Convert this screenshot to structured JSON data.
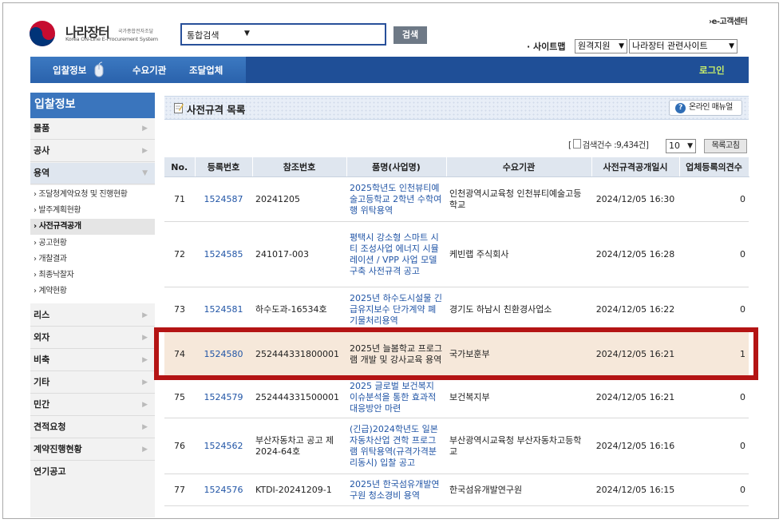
{
  "header": {
    "logo_title": "나라장터",
    "logo_tagline": "국가종합전자조달",
    "logo_subtitle": "Korea ON-Line E-Procurement System",
    "search_category": "통합검색",
    "search_button": "검색",
    "customer_center": "e-고객센터",
    "sitemap_label": "· 사이트맵",
    "dropdown1": "원격지원",
    "dropdown2": "나라장터 관련사이트"
  },
  "nav": {
    "items": [
      "입찰정보",
      "수요기관",
      "조달업체"
    ],
    "login": "로그인"
  },
  "sidebar": {
    "heading": "입찰정보",
    "items_top": [
      "물품",
      "공사",
      "용역"
    ],
    "sub_items": [
      "조달청계약요청 및 진행현황",
      "발주계획현황",
      "사전규격공개",
      "공고현황",
      "개찰결과",
      "최종낙찰자",
      "계약현황"
    ],
    "items_bottom": [
      "리스",
      "외자",
      "비축",
      "기타",
      "민간",
      "견적요청",
      "계약진행현황",
      "연기공고"
    ]
  },
  "main": {
    "title": "사전규격 목록",
    "manual_button": "온라인 매뉴얼",
    "count_text": "검색건수 :9,434건",
    "page_size": "10",
    "refresh_button": "목록고침",
    "columns": [
      "No.",
      "등록번호",
      "참조번호",
      "품명(사업명)",
      "수요기관",
      "사전규격공개일시",
      "업체등록의견수"
    ],
    "rows": [
      {
        "no": "71",
        "reg": "1524587",
        "ref": "20241205",
        "name": "2025학년도 인천뷰티예술고등학교 2학년 수학여행 위탁용역",
        "agency": "인천광역시교육청 인천뷰티예술고등학교",
        "date": "2024/12/05 16:30",
        "opinions": "0"
      },
      {
        "no": "72",
        "reg": "1524585",
        "ref": "241017-003",
        "name": "평택시 강소형 스마트 시티 조성사업 에너지 시뮬레이션 / VPP 사업 모델 구축 사전규격 공고",
        "agency": "케빈랩 주식회사",
        "date": "2024/12/05 16:28",
        "opinions": "0"
      },
      {
        "no": "73",
        "reg": "1524581",
        "ref": "하수도과-16534호",
        "name": "2025년 하수도시설물 긴급유지보수 단가계약 폐기물처리용역",
        "agency": "경기도 하남시 친환경사업소",
        "date": "2024/12/05 16:22",
        "opinions": "0"
      },
      {
        "no": "74",
        "reg": "1524580",
        "ref": "252444331800001",
        "name": "2025년 늘봄학교 프로그램 개발 및 강사교육 용역",
        "agency": "국가보훈부",
        "date": "2024/12/05 16:21",
        "opinions": "1"
      },
      {
        "no": "75",
        "reg": "1524579",
        "ref": "252444331500001",
        "name": "2025 글로벌 보건복지 이슈분석을 통한 효과적 대응방안 마련",
        "agency": "보건복지부",
        "date": "2024/12/05 16:21",
        "opinions": "0"
      },
      {
        "no": "76",
        "reg": "1524562",
        "ref": "부산자동차고 공고 제2024-64호",
        "name": "(긴급)2024학년도 일본 자동차산업 견학 프로그램 위탁용역(규격가격분리동시) 입찰 공고",
        "agency": "부산광역시교육청 부산자동차고등학교",
        "date": "2024/12/05 16:16",
        "opinions": "0"
      },
      {
        "no": "77",
        "reg": "1524576",
        "ref": "KTDI-20241209-1",
        "name": "2025년 한국섬유개발연구원 청소경비 용역",
        "agency": "한국섬유개발연구원",
        "date": "2024/12/05 16:15",
        "opinions": "0"
      }
    ]
  },
  "colors": {
    "nav_blue": "#2a62ac",
    "nav_dark": "#1f4f97",
    "login_green": "#c9ef6a",
    "link_blue": "#2155a6",
    "highlight_red": "#b41414",
    "highlight_row": "#f6e8da"
  }
}
